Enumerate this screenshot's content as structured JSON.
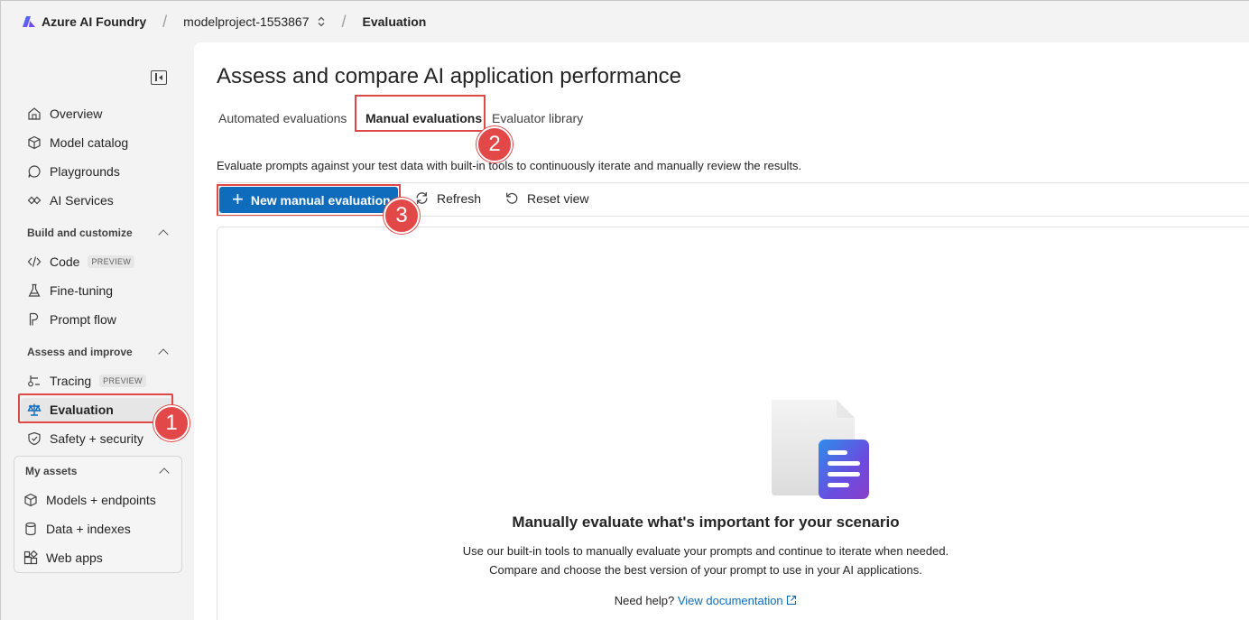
{
  "topbar": {
    "brand": "Azure AI Foundry",
    "project": "modelproject-1553867",
    "current": "Evaluation"
  },
  "sidebar": {
    "items": [
      {
        "label": "Overview",
        "icon": "home-icon"
      },
      {
        "label": "Model catalog",
        "icon": "cube-icon"
      },
      {
        "label": "Playgrounds",
        "icon": "chat-icon"
      },
      {
        "label": "AI Services",
        "icon": "services-icon"
      }
    ],
    "build_section": "Build and customize",
    "build_items": [
      {
        "label": "Code",
        "badge": "PREVIEW",
        "icon": "code-icon"
      },
      {
        "label": "Fine-tuning",
        "icon": "flask-icon"
      },
      {
        "label": "Prompt flow",
        "icon": "flow-icon"
      }
    ],
    "assess_section": "Assess and improve",
    "assess_items": [
      {
        "label": "Tracing",
        "badge": "PREVIEW",
        "icon": "tracing-icon"
      },
      {
        "label": "Evaluation",
        "icon": "scale-icon"
      },
      {
        "label": "Safety + security",
        "icon": "shield-icon"
      }
    ],
    "assets_section": "My assets",
    "assets_items": [
      {
        "label": "Models + endpoints",
        "icon": "cube-icon"
      },
      {
        "label": "Data + indexes",
        "icon": "database-icon"
      },
      {
        "label": "Web apps",
        "icon": "apps-icon"
      }
    ]
  },
  "main": {
    "title": "Assess and compare AI application performance",
    "tabs": [
      {
        "label": "Automated evaluations"
      },
      {
        "label": "Manual evaluations"
      },
      {
        "label": "Evaluator library"
      }
    ],
    "description": "Evaluate prompts against your test data with built-in tools to continuously iterate and manually review the results.",
    "toolbar": {
      "new_label": "New manual evaluation",
      "refresh_label": "Refresh",
      "reset_label": "Reset view"
    },
    "empty": {
      "title": "Manually evaluate what's important for your scenario",
      "line1": "Use our built-in tools to manually evaluate your prompts and continue to iterate when needed.",
      "line2": "Compare and choose the best version of your prompt to use in your AI applications.",
      "help_prefix": "Need help?",
      "help_link": "View documentation"
    }
  },
  "callouts": [
    "1",
    "2",
    "3"
  ],
  "colors": {
    "accent": "#0f6cbd",
    "callout": "#e34848",
    "highlight_box": "#e04848"
  }
}
